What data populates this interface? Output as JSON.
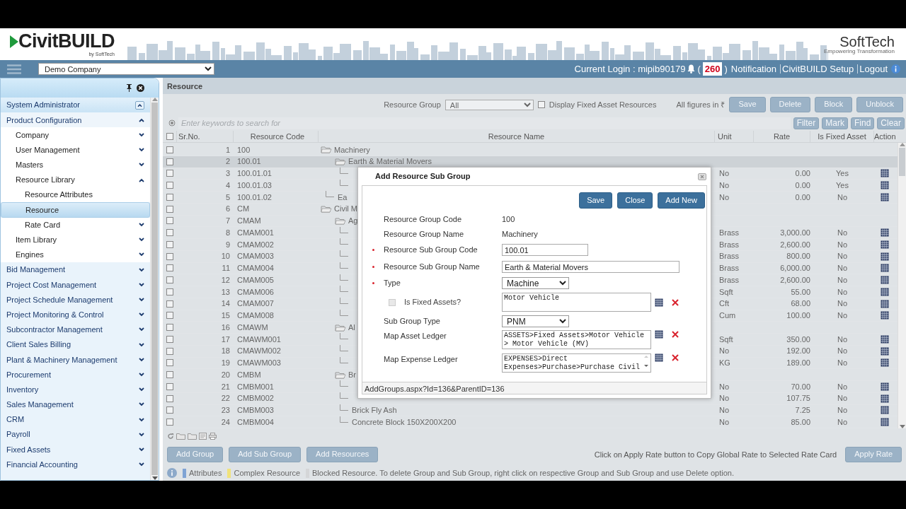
{
  "header": {
    "logo": {
      "name": "CivitBUILD",
      "tagline": "by SoftTech"
    },
    "partner_logo": {
      "name": "SoftTech",
      "tagline": "Empowering Transformation"
    },
    "company_select": {
      "value": "Demo Company"
    },
    "login": "Current Login : mipib90179",
    "notification_badge": {
      "open": "(",
      "count": "260",
      "close": ")"
    },
    "links": [
      "Notification",
      "CivitBUILD Setup",
      "Logout"
    ]
  },
  "sidebar": {
    "items": [
      {
        "label": "System Administrator",
        "expanded": true,
        "selected": false,
        "children": [
          {
            "label": "Product Configuration",
            "expanded": true,
            "selected": false,
            "children": [
              {
                "label": "Company",
                "expanded": false,
                "selected": false
              },
              {
                "label": "User Management",
                "expanded": false,
                "selected": false
              },
              {
                "label": "Masters",
                "expanded": false,
                "selected": false
              },
              {
                "label": "Resource Library",
                "expanded": true,
                "selected": false,
                "children": [
                  {
                    "label": "Resource Attributes",
                    "selected": false
                  },
                  {
                    "label": "Resource",
                    "selected": true
                  },
                  {
                    "label": "Rate Card",
                    "expanded": false,
                    "selected": false
                  }
                ]
              },
              {
                "label": "Item Library",
                "expanded": false,
                "selected": false
              },
              {
                "label": "Engines",
                "expanded": false,
                "selected": false
              }
            ]
          }
        ]
      },
      {
        "label": "Bid Management",
        "expanded": false,
        "selected": false
      },
      {
        "label": "Project Cost Management",
        "expanded": false,
        "selected": false
      },
      {
        "label": "Project Schedule Management",
        "expanded": false,
        "selected": false
      },
      {
        "label": "Project Monitoring & Control",
        "expanded": false,
        "selected": false
      },
      {
        "label": "Subcontractor Management",
        "expanded": false,
        "selected": false
      },
      {
        "label": "Client Sales Billing",
        "expanded": false,
        "selected": false
      },
      {
        "label": "Plant & Machinery Management",
        "expanded": false,
        "selected": false
      },
      {
        "label": "Procurement",
        "expanded": false,
        "selected": false
      },
      {
        "label": "Inventory",
        "expanded": false,
        "selected": false
      },
      {
        "label": "Sales Management",
        "expanded": false,
        "selected": false
      },
      {
        "label": "CRM",
        "expanded": false,
        "selected": false
      },
      {
        "label": "Payroll",
        "expanded": false,
        "selected": false
      },
      {
        "label": "Fixed Assets",
        "expanded": false,
        "selected": false
      },
      {
        "label": "Financial Accounting",
        "expanded": false,
        "selected": false
      }
    ]
  },
  "page_title": "Resource",
  "toolbar": {
    "group_label": "Resource Group",
    "group_value": "All",
    "display_fixed": {
      "label": "Display Fixed Asset Resources",
      "checked": false
    },
    "figures_note": "All figures in ₹",
    "buttons": [
      "Save",
      "Delete",
      "Block",
      "Unblock"
    ]
  },
  "search": {
    "placeholder": "Enter keywords to search for"
  },
  "grid_buttons": [
    "Filter",
    "Mark",
    "Find",
    "Clear"
  ],
  "table": {
    "select_all": false,
    "columns": [
      "Sr.No.",
      "Resource Code",
      "Resource Name",
      "Unit",
      "Rate",
      "Is Fixed Asset",
      "Action"
    ],
    "rows": [
      {
        "sr": "1",
        "code": "100",
        "name": "Machinery",
        "checked": false,
        "selected": false,
        "children": [
          {
            "sr": "2",
            "code": "100.01",
            "name": "Earth & Material Movers",
            "checked": false,
            "selected": true,
            "children": [
              {
                "sr": "3",
                "code": "100.01.01",
                "unit": "No",
                "rate": "0.00",
                "fixed_asset": "Yes",
                "checked": false,
                "selected": false
              },
              {
                "sr": "4",
                "code": "100.01.03",
                "unit": "No",
                "rate": "0.00",
                "fixed_asset": "Yes",
                "checked": false,
                "selected": false
              }
            ]
          },
          {
            "sr": "5",
            "code": "100.01.02",
            "name": "Ea",
            "unit": "No",
            "rate": "0.00",
            "fixed_asset": "No",
            "checked": false,
            "selected": false
          }
        ]
      },
      {
        "sr": "6",
        "code": "CM",
        "name": "Civil M",
        "checked": false,
        "selected": false,
        "children": [
          {
            "sr": "7",
            "code": "CMAM",
            "name": "Ag",
            "checked": false,
            "selected": false,
            "children": [
              {
                "sr": "8",
                "code": "CMAM001",
                "unit": "Brass",
                "rate": "3,000.00",
                "fixed_asset": "No",
                "checked": false,
                "selected": false
              },
              {
                "sr": "9",
                "code": "CMAM002",
                "unit": "Brass",
                "rate": "2,600.00",
                "fixed_asset": "No",
                "checked": false,
                "selected": false
              },
              {
                "sr": "10",
                "code": "CMAM003",
                "unit": "Brass",
                "rate": "800.00",
                "fixed_asset": "No",
                "checked": false,
                "selected": false
              },
              {
                "sr": "11",
                "code": "CMAM004",
                "unit": "Brass",
                "rate": "6,000.00",
                "fixed_asset": "No",
                "checked": false,
                "selected": false
              },
              {
                "sr": "12",
                "code": "CMAM005",
                "unit": "Brass",
                "rate": "2,600.00",
                "fixed_asset": "No",
                "checked": false,
                "selected": false
              },
              {
                "sr": "13",
                "code": "CMAM006",
                "unit": "Sqft",
                "rate": "55.00",
                "fixed_asset": "No",
                "checked": false,
                "selected": false
              },
              {
                "sr": "14",
                "code": "CMAM007",
                "unit": "Cft",
                "rate": "68.00",
                "fixed_asset": "No",
                "checked": false,
                "selected": false
              },
              {
                "sr": "15",
                "code": "CMAM008",
                "unit": "Cum",
                "rate": "100.00",
                "fixed_asset": "No",
                "checked": false,
                "selected": false
              }
            ]
          },
          {
            "sr": "16",
            "code": "CMAWM",
            "name": "Al",
            "checked": false,
            "selected": false,
            "children": [
              {
                "sr": "17",
                "code": "CMAWM001",
                "unit": "Sqft",
                "rate": "350.00",
                "fixed_asset": "No",
                "checked": false,
                "selected": false
              },
              {
                "sr": "18",
                "code": "CMAWM002",
                "unit": "No",
                "rate": "192.00",
                "fixed_asset": "No",
                "checked": false,
                "selected": false
              },
              {
                "sr": "19",
                "code": "CMAWM003",
                "unit": "KG",
                "rate": "189.00",
                "fixed_asset": "No",
                "checked": false,
                "selected": false
              }
            ]
          },
          {
            "sr": "20",
            "code": "CMBM",
            "name": "Br",
            "checked": false,
            "selected": false,
            "children": [
              {
                "sr": "21",
                "code": "CMBM001",
                "unit": "No",
                "rate": "70.00",
                "fixed_asset": "No",
                "checked": false,
                "selected": false
              },
              {
                "sr": "22",
                "code": "CMBM002",
                "unit": "No",
                "rate": "107.75",
                "fixed_asset": "No",
                "checked": false,
                "selected": false
              },
              {
                "sr": "23",
                "code": "CMBM003",
                "name": "Brick Fly Ash",
                "unit": "No",
                "rate": "7.25",
                "fixed_asset": "No",
                "checked": false,
                "selected": false
              },
              {
                "sr": "24",
                "code": "CMBM004",
                "name": "Concrete Block 150X200X200",
                "unit": "No",
                "rate": "85.00",
                "fixed_asset": "No",
                "checked": false,
                "selected": false
              }
            ]
          }
        ]
      }
    ]
  },
  "bottom_buttons": [
    "Add Group",
    "Add Sub Group",
    "Add Resources"
  ],
  "apply_note": "Click on Apply Rate button to Copy Global Rate to Selected Rate Card",
  "apply_button": "Apply Rate",
  "legend": [
    {
      "label": "Attributes",
      "color": "#7fa3d4"
    },
    {
      "label": "Complex Resource",
      "color": "#f0e27c"
    },
    {
      "label": "Blocked Resource. To delete Group and Sub Group, right click on respective Group and Sub Group and use Delete option.",
      "color": "#d4d6d8"
    }
  ],
  "dialog": {
    "title": "Add Resource Sub Group",
    "buttons": [
      "Save",
      "Close",
      "Add New"
    ],
    "fields": [
      {
        "kind": "static",
        "label": "Resource Group Code",
        "value": "100"
      },
      {
        "kind": "static",
        "label": "Resource Group Name",
        "value": "Machinery"
      },
      {
        "kind": "text",
        "label": "Resource Sub Group Code",
        "required": true,
        "value": "100.01"
      },
      {
        "kind": "text",
        "label": "Resource Sub Group Name",
        "required": true,
        "value": "Earth & Material Movers"
      },
      {
        "kind": "select",
        "label": "Type",
        "required": true,
        "value": "Machine"
      },
      {
        "kind": "checkbox",
        "label": "Is Fixed Assets?",
        "checked": false,
        "disabled": true,
        "value": "Motor Vehicle"
      },
      {
        "kind": "select",
        "label": "Sub Group Type",
        "value": "PNM"
      },
      {
        "kind": "ledger",
        "label": "Map Asset Ledger",
        "value": "ASSETS>Fixed Assets>Motor Vehicle > Motor Vehicle (MV)"
      },
      {
        "kind": "ledger",
        "label": "Map Expense Ledger",
        "value": "EXPENSES>Direct Expenses>Purchase>Purchase Civil",
        "scrollable": true
      }
    ],
    "status": "AddGroups.aspx?Id=136&ParentID=136"
  }
}
